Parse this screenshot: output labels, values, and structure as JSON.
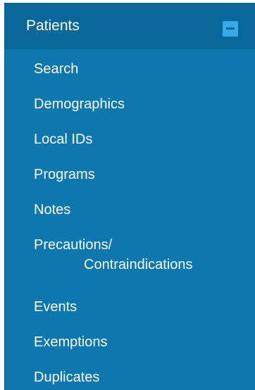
{
  "header": {
    "title": "Patients",
    "collapse_icon": "minus-square-icon"
  },
  "nav": {
    "items": [
      {
        "label": "Search"
      },
      {
        "label": "Demographics"
      },
      {
        "label": "Local IDs"
      },
      {
        "label": "Programs"
      },
      {
        "label": "Notes"
      },
      {
        "label": "Precautions/",
        "label_line2": "Contraindications"
      },
      {
        "label": "Events"
      },
      {
        "label": "Exemptions"
      },
      {
        "label": "Duplicates"
      }
    ]
  },
  "colors": {
    "panel_bg": "#0e77ad",
    "header_bg": "#0a679a",
    "collapse_button": "#35a9ea",
    "text": "#ffffff"
  }
}
